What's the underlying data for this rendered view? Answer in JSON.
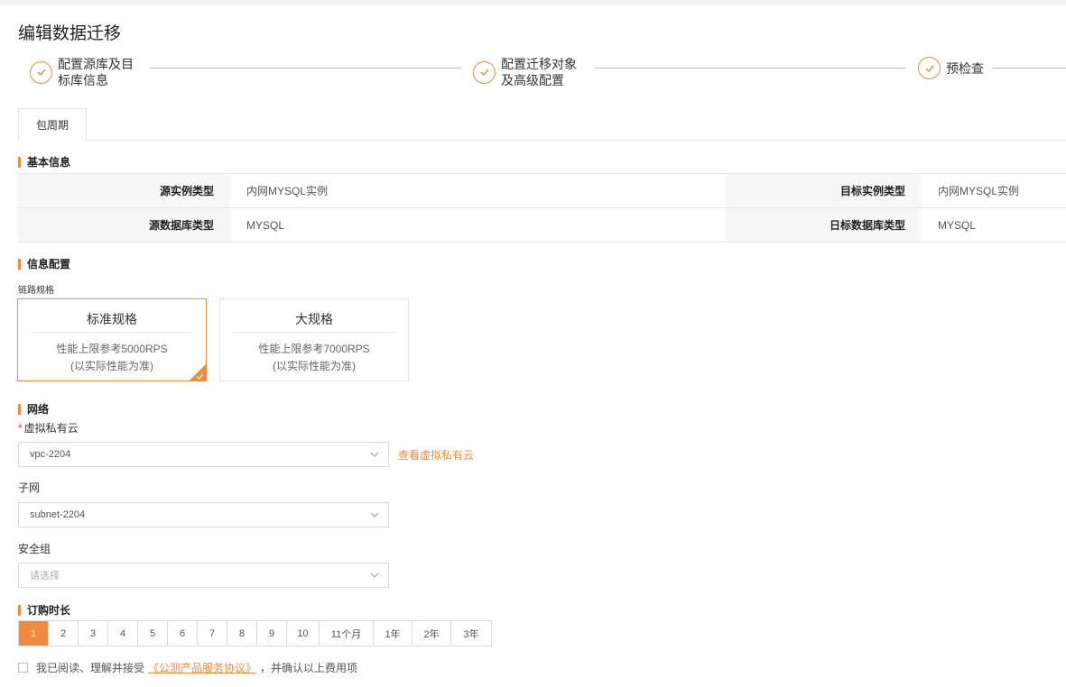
{
  "page": {
    "title": "编辑数据迁移"
  },
  "steps": [
    {
      "line1": "配置源库及目",
      "line2": "标库信息"
    },
    {
      "line1": "配置迁移对象",
      "line2": "及高级配置"
    },
    {
      "line1": "预检查",
      "line2": ""
    }
  ],
  "tabs": [
    {
      "label": "包周期"
    }
  ],
  "basic": {
    "title": "基本信息",
    "rows": [
      {
        "label1": "源实例类型",
        "value1": "内网MYSQL实例",
        "label2": "目标实例类型",
        "value2": "内网MYSQL实例"
      },
      {
        "label1": "源数据库类型",
        "value1": "MYSQL",
        "label2": "日标数据库类型",
        "value2": "MYSQL"
      }
    ]
  },
  "config": {
    "title": "信息配置",
    "link_spec_label": "链路规格",
    "specs": [
      {
        "title": "标准规格",
        "desc1": "性能上限参考5000RPS",
        "desc2": "(以实际性能为准)",
        "selected": true
      },
      {
        "title": "大规格",
        "desc1": "性能上限参考7000RPS",
        "desc2": "(以实际性能为准)",
        "selected": false
      }
    ]
  },
  "network": {
    "title": "网络",
    "vpc_required_mark": "*",
    "vpc_label": "虚拟私有云",
    "vpc_value": "vpc-2204",
    "vpc_link": "查看虚拟私有云",
    "subnet_label": "子网",
    "subnet_value": "subnet-2204",
    "sg_label": "安全组",
    "sg_placeholder": "请选择"
  },
  "duration": {
    "title": "订购时长",
    "options": [
      "1",
      "2",
      "3",
      "4",
      "5",
      "6",
      "7",
      "8",
      "9",
      "10",
      "11个月",
      "1年",
      "2年",
      "3年"
    ],
    "selected": "1"
  },
  "agreement": {
    "prefix": "我已阅读、理解并接受",
    "link": "《公测产品服务协议》",
    "suffix": "，并确认以上费用项"
  },
  "colors": {
    "accent": "#f08a3c"
  }
}
